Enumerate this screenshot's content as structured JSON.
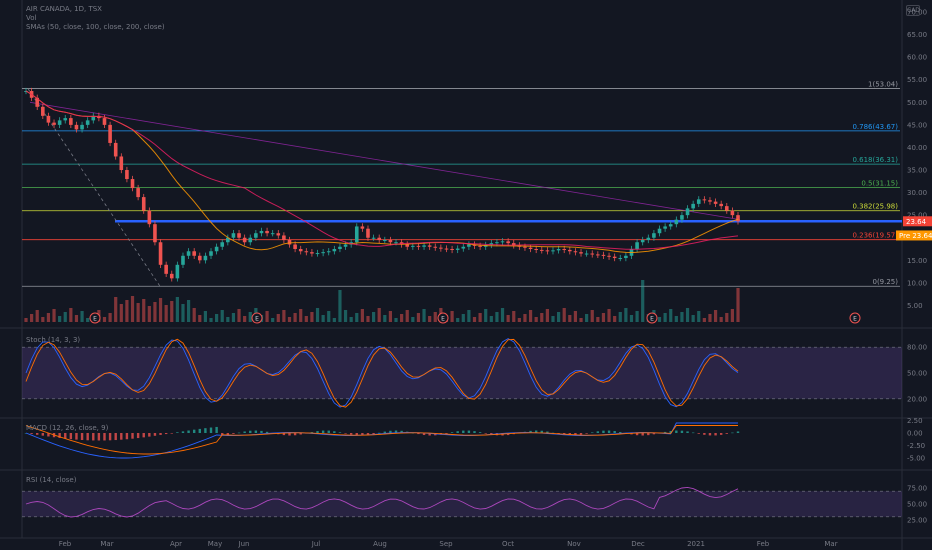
{
  "header": {
    "symbol_line": "AIR CANADA, 1D, TSX",
    "vol_label": "Vol",
    "sma_label": "SMAs (50, close, 100, close, 200, close)",
    "settings_badge": "CAD"
  },
  "indicators": {
    "stoch_label": "Stoch (14, 3, 3)",
    "macd_label": "MACD (12, 26, close, 9)",
    "rsi_label": "RSI (14, close)"
  },
  "price_tags": {
    "last": "23.64",
    "pre": "Pre  23.64"
  },
  "earnings_marker": "E",
  "chart_data": {
    "type": "line",
    "title": "AIR CANADA, 1D, TSX",
    "x_ticks": [
      "Feb",
      "Mar",
      "Apr",
      "May",
      "Jun",
      "Jul",
      "Aug",
      "Sep",
      "Oct",
      "Nov",
      "Dec",
      "2021",
      "Feb",
      "Mar"
    ],
    "y_ticks": [
      70,
      65,
      60,
      55,
      50,
      45,
      40,
      35,
      30,
      25,
      20,
      15,
      10,
      5
    ],
    "ylim": [
      0,
      72
    ],
    "fib_levels": [
      {
        "label": "1(53.04)",
        "value": 53.04,
        "color": "#9598a1"
      },
      {
        "label": "0.786(43.67)",
        "value": 43.67,
        "color": "#2196f3"
      },
      {
        "label": "0.618(36.31)",
        "value": 36.31,
        "color": "#26a69a"
      },
      {
        "label": "0.5(31.15)",
        "value": 31.15,
        "color": "#4caf50"
      },
      {
        "label": "0.382(25.98)",
        "value": 25.98,
        "color": "#cddc39"
      },
      {
        "label": "0.236(19.57)",
        "value": 19.57,
        "color": "#f44336"
      },
      {
        "label": "0(9.25)",
        "value": 9.25,
        "color": "#9598a1"
      }
    ],
    "support_line": 23.64,
    "series": [
      {
        "values": [
          52.5,
          51,
          49,
          47,
          45.5,
          45,
          46,
          46.5,
          45,
          44,
          45,
          46,
          47,
          46.5,
          45,
          41,
          38,
          35,
          33,
          31,
          29,
          26,
          23,
          19,
          14,
          12,
          11,
          14,
          16,
          17,
          16,
          15,
          16,
          17,
          18,
          19,
          20,
          21,
          20,
          19,
          20,
          21,
          21.5,
          21,
          21,
          20.5,
          19.5,
          18.5,
          17.5,
          17,
          16.8,
          16.5,
          16.6,
          16.8,
          17,
          17.5,
          18,
          18.5,
          19,
          22.5,
          22,
          20,
          20,
          19.5,
          19.5,
          19,
          19,
          18.5,
          18,
          18.2,
          18,
          18.3,
          18,
          17.8,
          17.6,
          17.5,
          17.3,
          17.6,
          18,
          18.5,
          18.2,
          18,
          18.4,
          18.8,
          19,
          19.2,
          18.8,
          18.3,
          18,
          17.8,
          17.5,
          17.3,
          17.2,
          17,
          17.2,
          17.5,
          17.3,
          17,
          16.8,
          16.5,
          16.5,
          16.3,
          16.2,
          16,
          15.8,
          15.5,
          15.5,
          16,
          17.5,
          19,
          19.5,
          20,
          21,
          22,
          22.5,
          23,
          24,
          25,
          26.5,
          27.5,
          28.5,
          28.3,
          28,
          27.5,
          27,
          26,
          25,
          23.64
        ]
      }
    ],
    "stoch": {
      "labels": [
        "80.00",
        "50.00",
        "20.00"
      ],
      "range": [
        0,
        100
      ]
    },
    "macd": {
      "labels": [
        "2.50",
        "0.00",
        "-2.50",
        "-5.00"
      ]
    },
    "rsi": {
      "labels": [
        "75.00",
        "50.00",
        "25.00"
      ],
      "range": [
        0,
        100
      ]
    }
  }
}
